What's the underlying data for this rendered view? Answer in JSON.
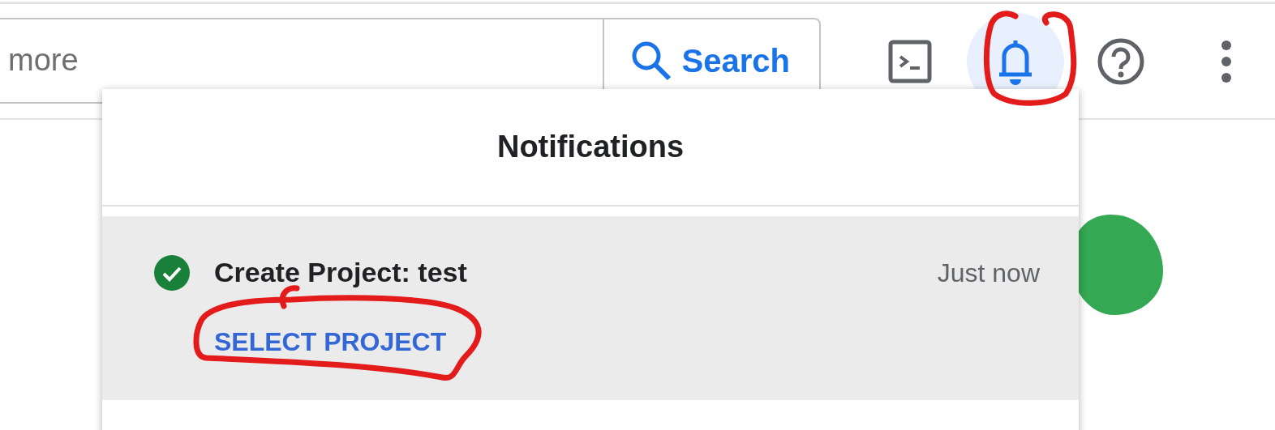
{
  "search": {
    "placeholder": "more",
    "button": "Search"
  },
  "toolbar": [
    {
      "kind": "terminal",
      "selected": false
    },
    {
      "kind": "bell",
      "selected": true
    },
    {
      "kind": "help",
      "selected": false
    },
    {
      "kind": "more",
      "selected": false
    }
  ],
  "notifications": {
    "title": "Notifications",
    "items": [
      {
        "kind": "success",
        "title": "Create Project: test",
        "time": "Just now",
        "action": "SELECT PROJECT"
      }
    ]
  }
}
